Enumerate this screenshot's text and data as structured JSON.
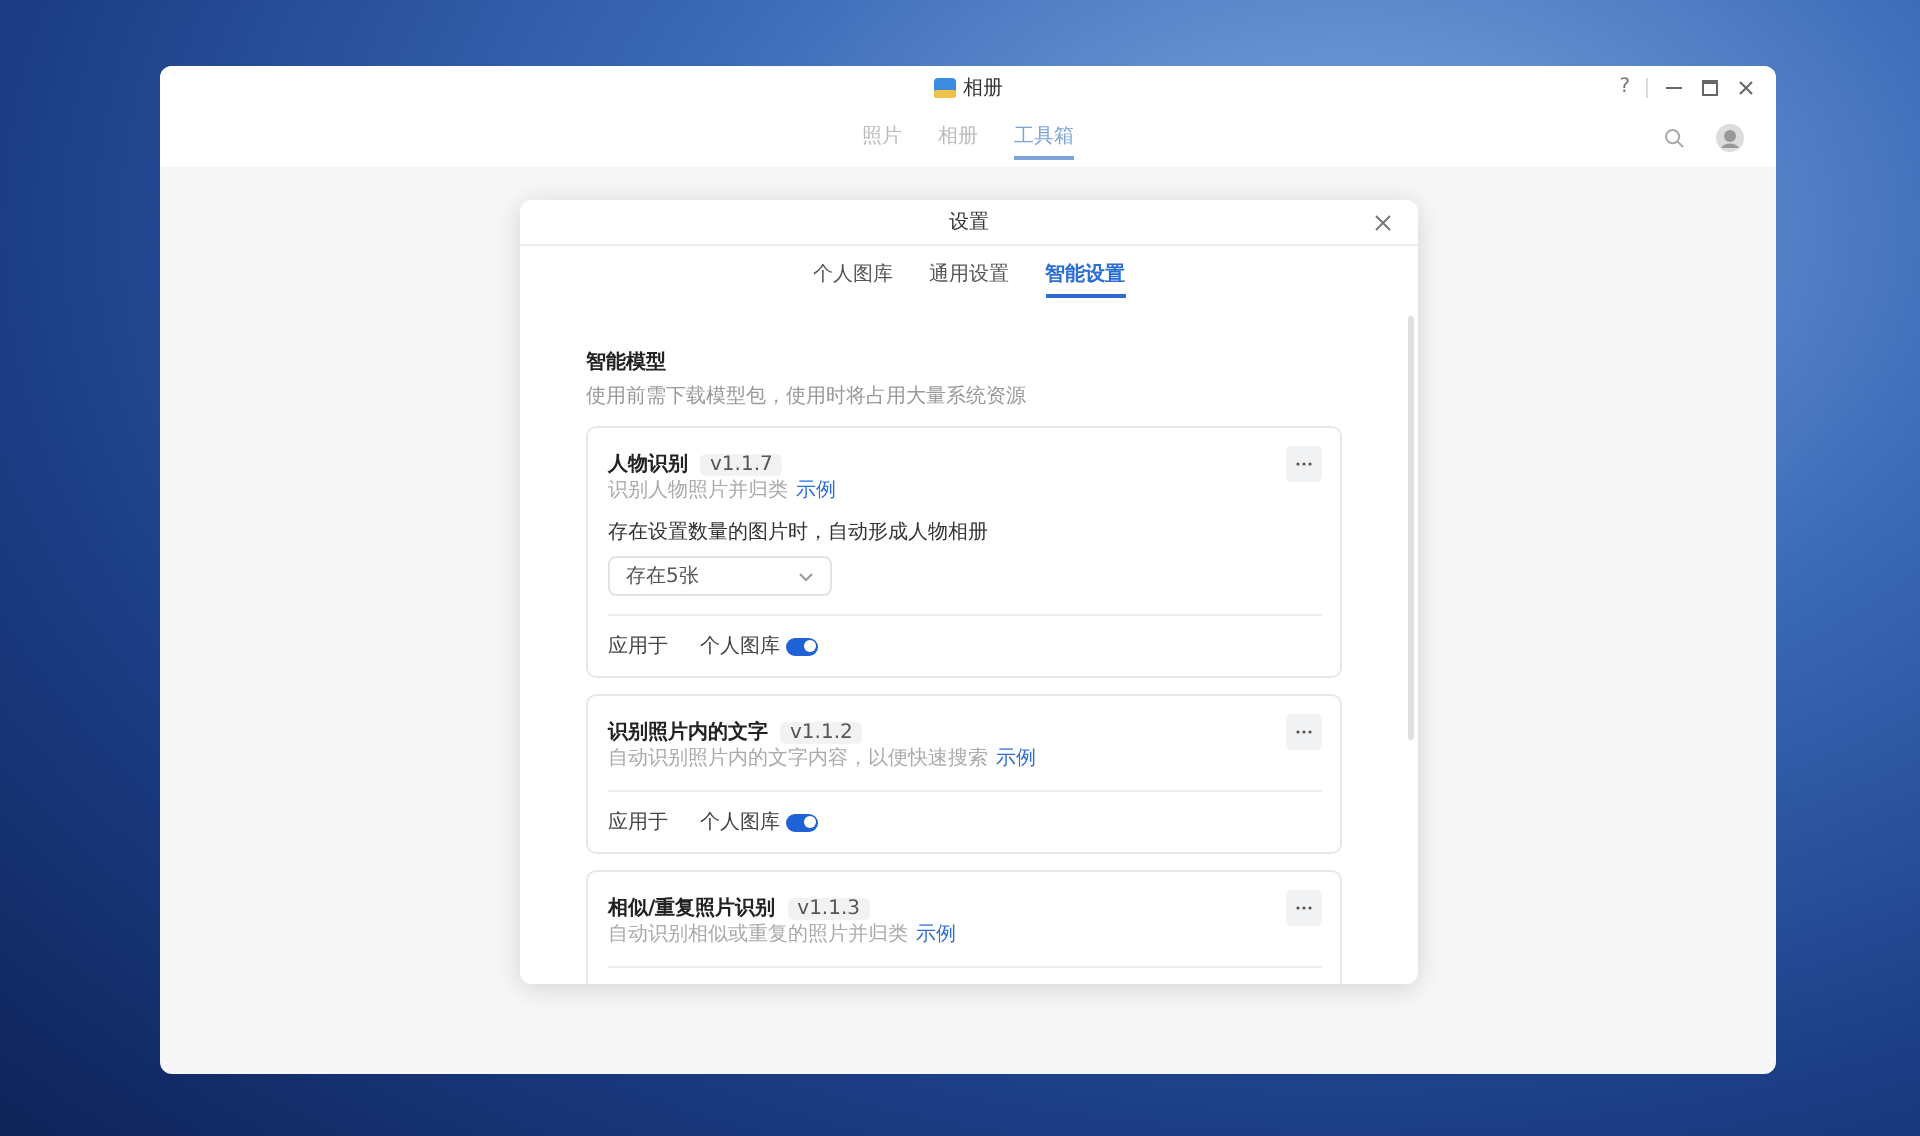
{
  "window": {
    "title": "相册",
    "help": "?",
    "nav_tabs": [
      {
        "label": "照片",
        "selected": false
      },
      {
        "label": "相册",
        "selected": false
      },
      {
        "label": "工具箱",
        "selected": true
      }
    ]
  },
  "dialog": {
    "title": "设置",
    "tabs": [
      {
        "label": "个人图库",
        "selected": false
      },
      {
        "label": "通用设置",
        "selected": false
      },
      {
        "label": "智能设置",
        "selected": true
      }
    ],
    "section": {
      "title": "智能模型",
      "description": "使用前需下载模型包，使用时将占用大量系统资源"
    },
    "models": [
      {
        "name": "人物识别",
        "version": "v1.1.7",
        "description": "识别人物照片并归类",
        "link": "示例",
        "setting_label": "存在设置数量的图片时，自动形成人物相册",
        "dropdown_value": "存在5张",
        "applies_label": "应用于",
        "library_label": "个人图库",
        "on": true
      },
      {
        "name": "识别照片内的文字",
        "version": "v1.1.2",
        "description": "自动识别照片内的文字内容，以便快速搜索",
        "link": "示例",
        "applies_label": "应用于",
        "library_label": "个人图库",
        "on": true
      },
      {
        "name": "相似/重复照片识别",
        "version": "v1.1.3",
        "description": "自动识别相似或重复的照片并归类",
        "link": "示例"
      }
    ]
  }
}
